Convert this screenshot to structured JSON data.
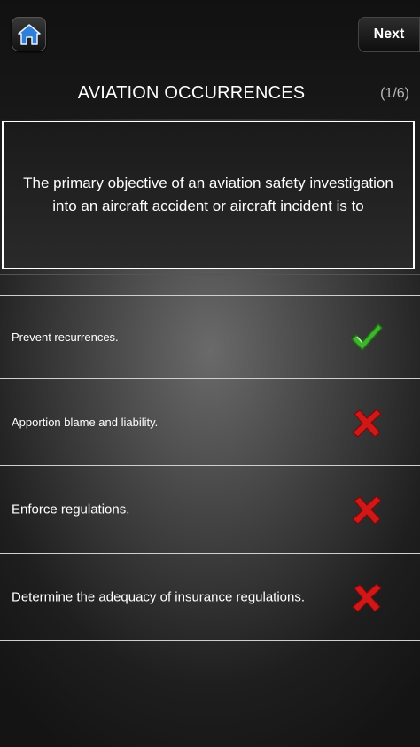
{
  "header": {
    "home_icon": "home-icon",
    "next_label": "Next",
    "title": "AVIATION OCCURRENCES",
    "counter": "(1/6)"
  },
  "question": {
    "text": "The primary objective of an aviation safety investigation into an aircraft accident or aircraft incident is to"
  },
  "answers": [
    {
      "text": "Prevent recurrences.",
      "status_icon": "checkmark-icon",
      "correct": true
    },
    {
      "text": "Apportion blame and liability.",
      "status_icon": "x-mark-icon",
      "correct": false
    },
    {
      "text": "Enforce regulations.",
      "status_icon": "x-mark-icon",
      "correct": false
    },
    {
      "text": "Determine the adequacy of insurance regulations.",
      "status_icon": "x-mark-icon",
      "correct": false
    }
  ],
  "colors": {
    "correct": "#3fb52e",
    "incorrect": "#d01818"
  }
}
